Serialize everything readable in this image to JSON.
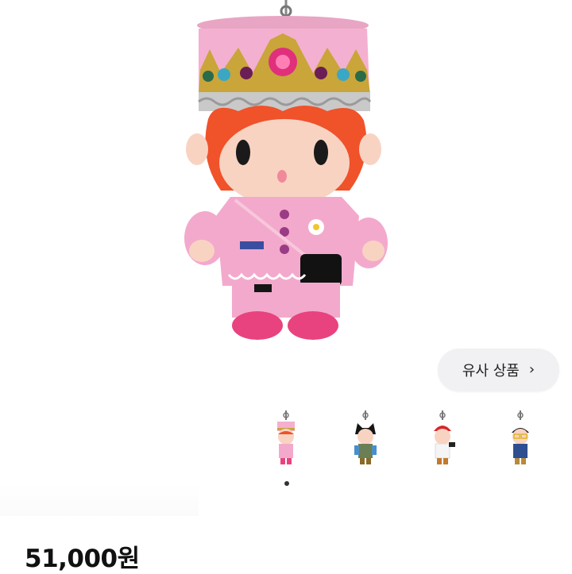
{
  "product": {
    "image": "pink-crown-plush-keyring",
    "price": "51,000원"
  },
  "similar": {
    "label": "유사 상품",
    "chevron": "›"
  },
  "thumbnails": [
    {
      "name": "pink-crown-plush",
      "active": true
    },
    {
      "name": "black-hood-plush",
      "active": false
    },
    {
      "name": "red-cap-plush",
      "active": false
    },
    {
      "name": "glasses-plush",
      "active": false
    }
  ],
  "colors": {
    "accent_pink": "#f3a9cc",
    "button_bg": "#f1f1f3",
    "price_text": "#111111"
  }
}
